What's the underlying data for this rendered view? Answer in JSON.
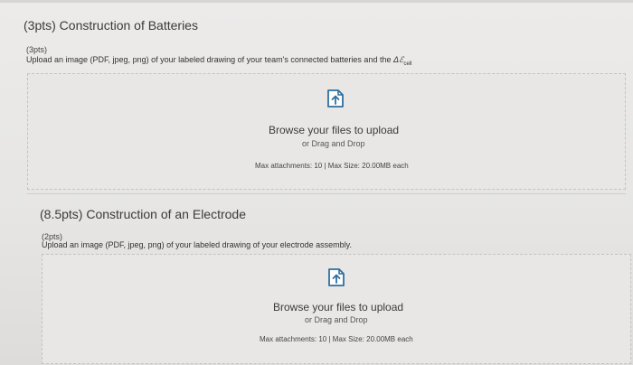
{
  "section1": {
    "title": "(3pts) Construction of Batteries",
    "points": "(3pts)",
    "instruction_prefix": "Upload an image (PDF, jpeg, png) of your labeled drawing of your team's connected batteries and the ",
    "instruction_symbol": "Δℰ",
    "instruction_subscript": "cell",
    "upload": {
      "icon": "upload-file-icon",
      "browse_label": "Browse your files to upload",
      "drag_label": "or Drag and Drop",
      "limits": "Max attachments: 10 | Max Size: 20.00MB each"
    }
  },
  "section2": {
    "title": "(8.5pts) Construction of an Electrode",
    "points": "(2pts)",
    "instruction": "Upload an image (PDF, jpeg, png) of your labeled drawing of your electrode assembly.",
    "upload": {
      "icon": "upload-file-icon",
      "browse_label": "Browse your files to upload",
      "drag_label": "or Drag and Drop",
      "limits": "Max attachments: 10 | Max Size: 20.00MB each"
    }
  },
  "colors": {
    "icon_blue": "#2f6f9f",
    "background": "#e7e6e4"
  }
}
